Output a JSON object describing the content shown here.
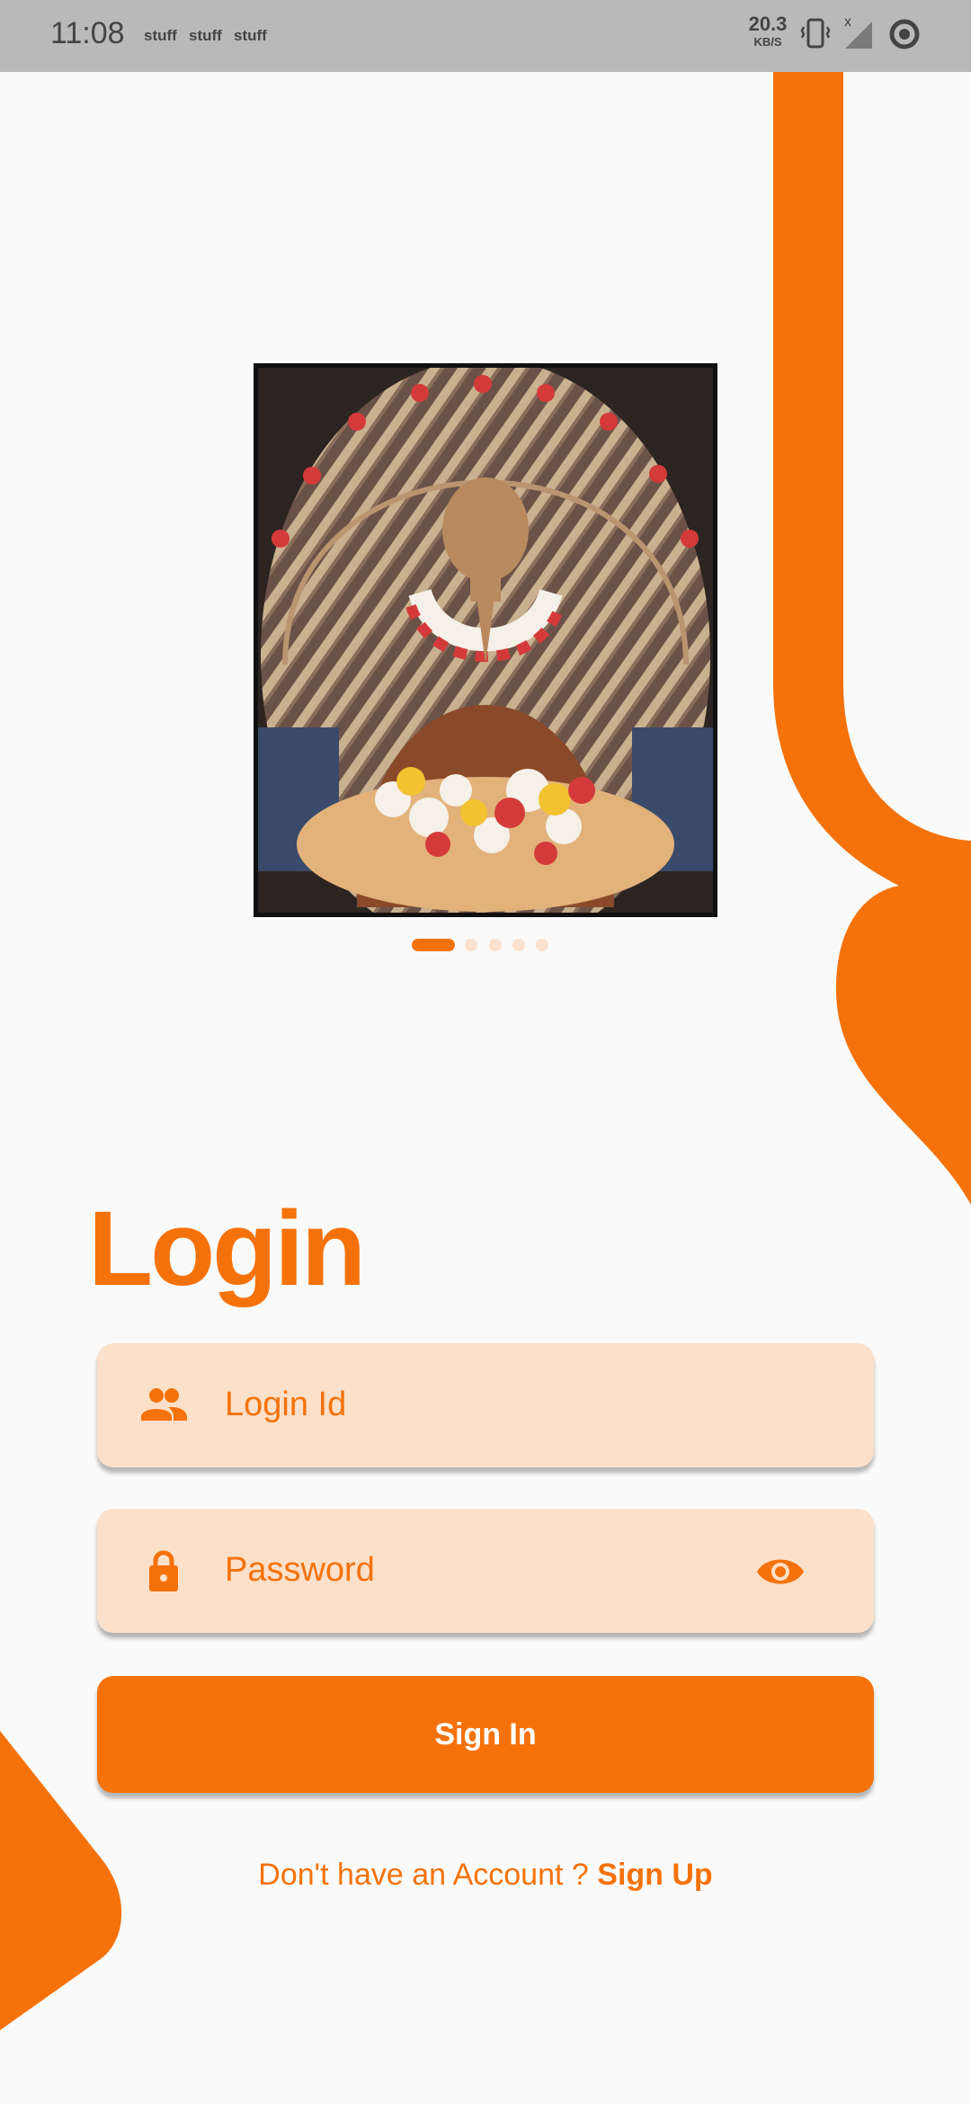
{
  "status_bar": {
    "time": "11:08",
    "notifications": [
      "stuff",
      "stuff",
      "stuff"
    ],
    "net_speed_value": "20.3",
    "net_speed_unit": "KB/S",
    "icons": [
      "vibrate-icon",
      "signal-no-service-icon",
      "sync-icon"
    ]
  },
  "carousel": {
    "image_name": "devotee-portrait-photo",
    "page_count": 5,
    "active_index": 0
  },
  "login": {
    "title": "Login",
    "login_id_placeholder": "Login Id",
    "password_placeholder": "Password",
    "sign_in_label": "Sign In",
    "signup_prompt": "Don't have an Account ?",
    "signup_link": "Sign Up"
  },
  "colors": {
    "accent": "#f5720a",
    "field_background": "#fde0c9",
    "page_background": "#fafafa",
    "status_bar": "#b9b9b9"
  }
}
